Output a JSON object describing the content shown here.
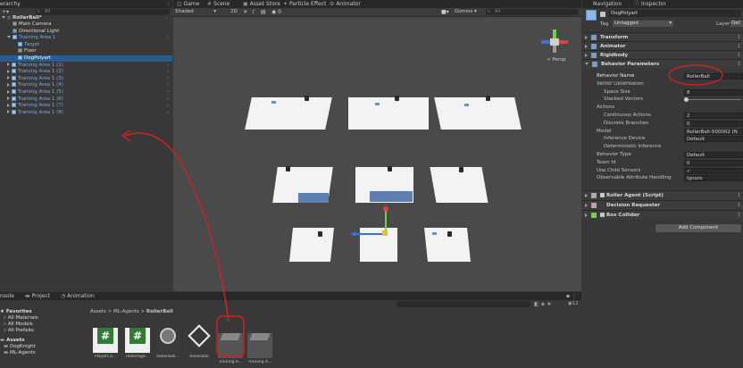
{
  "hierarchy": {
    "tab": "erarchy",
    "search_placeholder": "All",
    "scene": "RollerBall*",
    "items": [
      {
        "label": "Main Camera",
        "indent": 2,
        "style": "white",
        "arrow": ""
      },
      {
        "label": "Directional Light",
        "indent": 2,
        "style": "white",
        "arrow": ""
      },
      {
        "label": "Training Area 1",
        "indent": 1,
        "style": "blue",
        "arrow": "down"
      },
      {
        "label": "Target",
        "indent": 3,
        "style": "blue",
        "arrow": ""
      },
      {
        "label": "Floor",
        "indent": 3,
        "style": "white",
        "arrow": ""
      },
      {
        "label": "DogPolyart",
        "indent": 3,
        "style": "white",
        "arrow": "",
        "selected": true
      },
      {
        "label": "Training Area 1 (1)",
        "indent": 1,
        "style": "blue",
        "arrow": "right"
      },
      {
        "label": "Training Area 1 (2)",
        "indent": 1,
        "style": "blue",
        "arrow": "right"
      },
      {
        "label": "Training Area 1 (3)",
        "indent": 1,
        "style": "blue",
        "arrow": "right"
      },
      {
        "label": "Training Area 1 (4)",
        "indent": 1,
        "style": "blue",
        "arrow": "right"
      },
      {
        "label": "Training Area 1 (5)",
        "indent": 1,
        "style": "blue",
        "arrow": "right"
      },
      {
        "label": "Training Area 1 (6)",
        "indent": 1,
        "style": "blue",
        "arrow": "right"
      },
      {
        "label": "Training Area 1 (7)",
        "indent": 1,
        "style": "blue",
        "arrow": "right"
      },
      {
        "label": "Training Area 1 (8)",
        "indent": 1,
        "style": "blue",
        "arrow": "right"
      }
    ]
  },
  "scene_view": {
    "tabs": [
      "Game",
      "Scene",
      "Asset Store",
      "Particle Effect",
      "Animator"
    ],
    "shading_mode": "Shaded",
    "toggle_2d": "2D",
    "gizmos": "Gizmos",
    "search_placeholder": "All",
    "perspective_label": "< Persp"
  },
  "inspector": {
    "tabs": [
      "Navigation",
      "Inspector"
    ],
    "object_name": "DogPolyart",
    "tag_label": "Tag",
    "tag_value": "Untagged",
    "layer_label": "Layer",
    "layer_value": "Def",
    "components_top": [
      "Transform",
      "Animator",
      "Rigidbody",
      "Behavior Parameters"
    ],
    "fields": [
      {
        "label": "Behavior Name",
        "value": "RollerBall",
        "indent": 0
      },
      {
        "label": "Vector Observation",
        "value": "",
        "indent": 0
      },
      {
        "label": "Space Size",
        "value": "8",
        "indent": 1
      },
      {
        "label": "Stacked Vectors",
        "value": "",
        "indent": 1,
        "slider": true
      },
      {
        "label": "Actions",
        "value": "",
        "indent": 0
      },
      {
        "label": "Continuous Actions",
        "value": "2",
        "indent": 1
      },
      {
        "label": "Discrete Branches",
        "value": "0",
        "indent": 1
      },
      {
        "label": "Model",
        "value": "RollerBall-500002 (N",
        "indent": 0
      },
      {
        "label": "Inference Device",
        "value": "Default",
        "indent": 1
      },
      {
        "label": "Deterministic Inference",
        "value": "",
        "indent": 1
      },
      {
        "label": "Behavior Type",
        "value": "Default",
        "indent": 0
      },
      {
        "label": "Team Id",
        "value": "0",
        "indent": 0
      },
      {
        "label": "Use Child Sensors",
        "value": "✓",
        "indent": 0
      },
      {
        "label": "Observable Attribute Handling",
        "value": "Ignore",
        "indent": 0
      }
    ],
    "components_bottom": [
      "Roller Agent (Script)",
      "Decision Requester",
      "Box Collider"
    ],
    "add_component": "Add Component"
  },
  "bottom_panel": {
    "tabs": [
      "nsole",
      "Project",
      "Animation"
    ],
    "favorites_label": "Favorites",
    "favorites": [
      "All Materials",
      "All Models",
      "All Prefabs"
    ],
    "assets_label": "Assets",
    "assets_children": [
      "DogKnight",
      "ML-Agents"
    ],
    "breadcrumb": [
      "Assets",
      "ML-Agents",
      "RollerBall"
    ],
    "zoom_count": "12",
    "assets": [
      {
        "label": "PlayerCo...",
        "kind": "script"
      },
      {
        "label": "RollerAge...",
        "kind": "script"
      },
      {
        "label": "RollerBall...",
        "kind": "model"
      },
      {
        "label": "RollerBall",
        "kind": "unity"
      },
      {
        "label": "Training A...",
        "kind": "prefab"
      },
      {
        "label": "Training A...",
        "kind": "prefab"
      }
    ]
  },
  "colors": {
    "panel": "#383838",
    "selected": "#2c5d87",
    "annotation": "#d42020",
    "scene_bg": "#4a4a4a"
  }
}
